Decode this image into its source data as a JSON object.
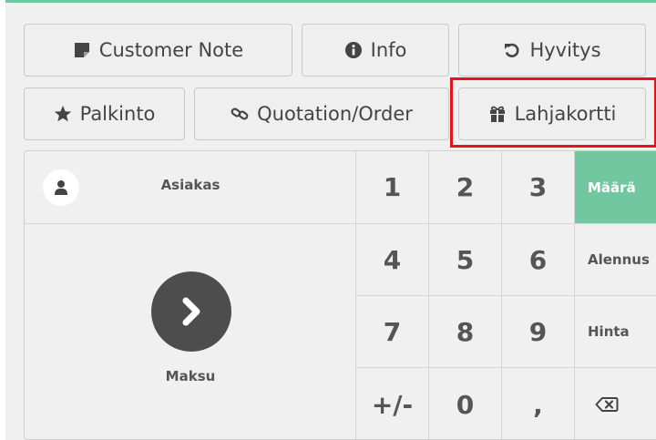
{
  "buttons": {
    "customer_note": "Customer Note",
    "info": "Info",
    "refund": "Hyvitys",
    "reward": "Palkinto",
    "quotation": "Quotation/Order",
    "gift_card": "Lahjakortti"
  },
  "customer": {
    "label": "Asiakas"
  },
  "payment": {
    "label": "Maksu"
  },
  "numpad": {
    "k1": "1",
    "k2": "2",
    "k3": "3",
    "k4": "4",
    "k5": "5",
    "k6": "6",
    "k7": "7",
    "k8": "8",
    "k9": "9",
    "plus_minus": "+/-",
    "k0": "0",
    "decimal": ","
  },
  "modes": {
    "quantity": "Määrä",
    "discount": "Alennus",
    "price": "Hinta",
    "active": "quantity"
  },
  "colors": {
    "accent": "#71c8a0",
    "highlight": "#e4141b"
  },
  "icons": [
    "note-icon",
    "info-icon",
    "undo-icon",
    "star-icon",
    "link-icon",
    "gift-icon",
    "user-icon",
    "chevron-right-icon",
    "backspace-icon"
  ]
}
